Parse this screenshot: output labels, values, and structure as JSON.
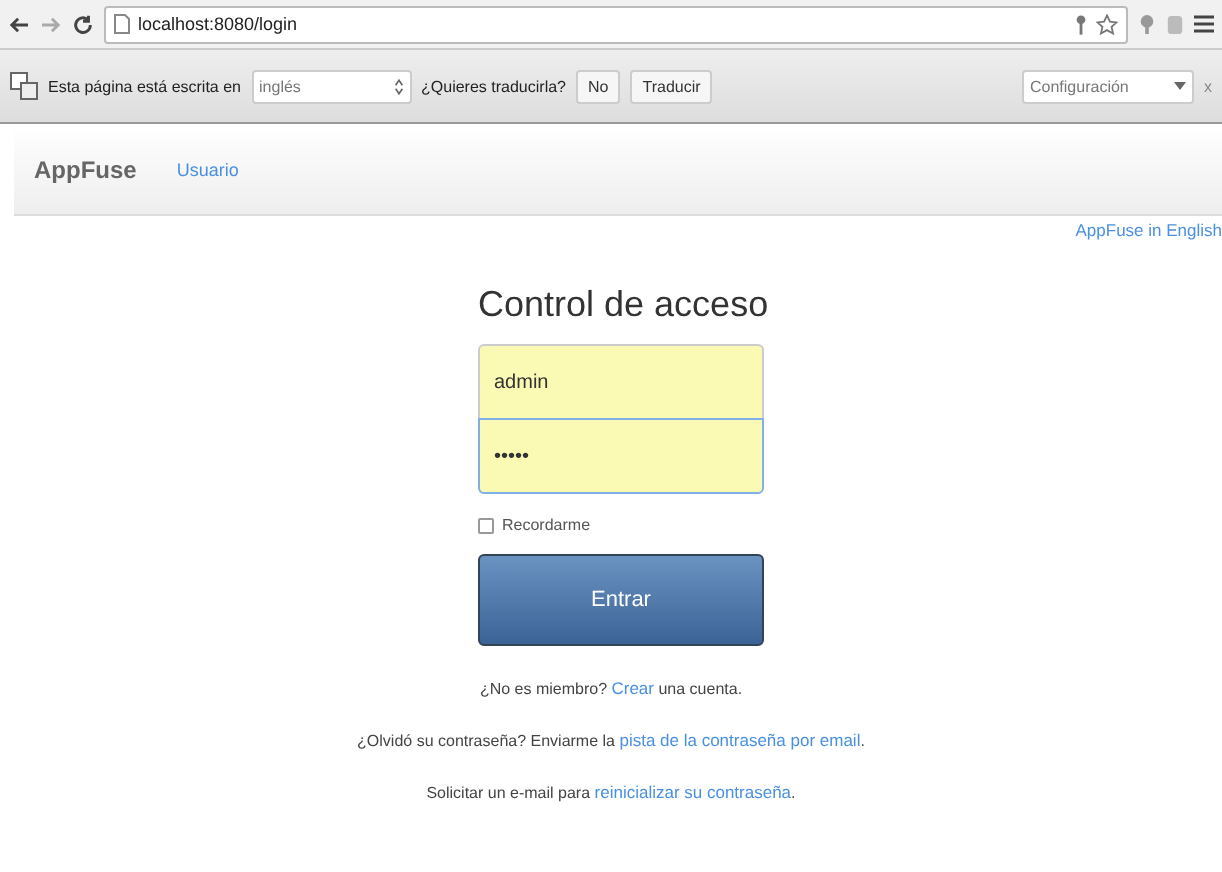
{
  "browser": {
    "address": "localhost:8080/login"
  },
  "translate_bar": {
    "message": "Esta página está escrita en",
    "language": "inglés",
    "question": "¿Quieres traducirla?",
    "buttons": [
      "No",
      "Traducir"
    ],
    "settings": "Configuración",
    "close": "x"
  },
  "navbar": {
    "brand": "AppFuse",
    "items": [
      "Usuario"
    ]
  },
  "language_link": "AppFuse in English",
  "login": {
    "title": "Control de acceso",
    "username": "admin",
    "password": "•••••",
    "remember": {
      "label": "Recordarme",
      "checked": false
    },
    "submit": "Entrar"
  },
  "help_lines": [
    [
      {
        "text": "¿No es miembro? ",
        "link": false
      },
      {
        "text": "Crear",
        "link": true
      },
      {
        "text": " una cuenta.",
        "link": false
      }
    ],
    [
      {
        "text": "¿Olvidó su contraseña? Enviarme la ",
        "link": false
      },
      {
        "text": "pista de la contraseña por email",
        "link": true
      },
      {
        "text": ".",
        "link": false
      }
    ],
    [
      {
        "text": "Solicitar un e-mail para ",
        "link": false
      },
      {
        "text": "reinicializar su contraseña",
        "link": true
      },
      {
        "text": ".",
        "link": false
      }
    ]
  ]
}
